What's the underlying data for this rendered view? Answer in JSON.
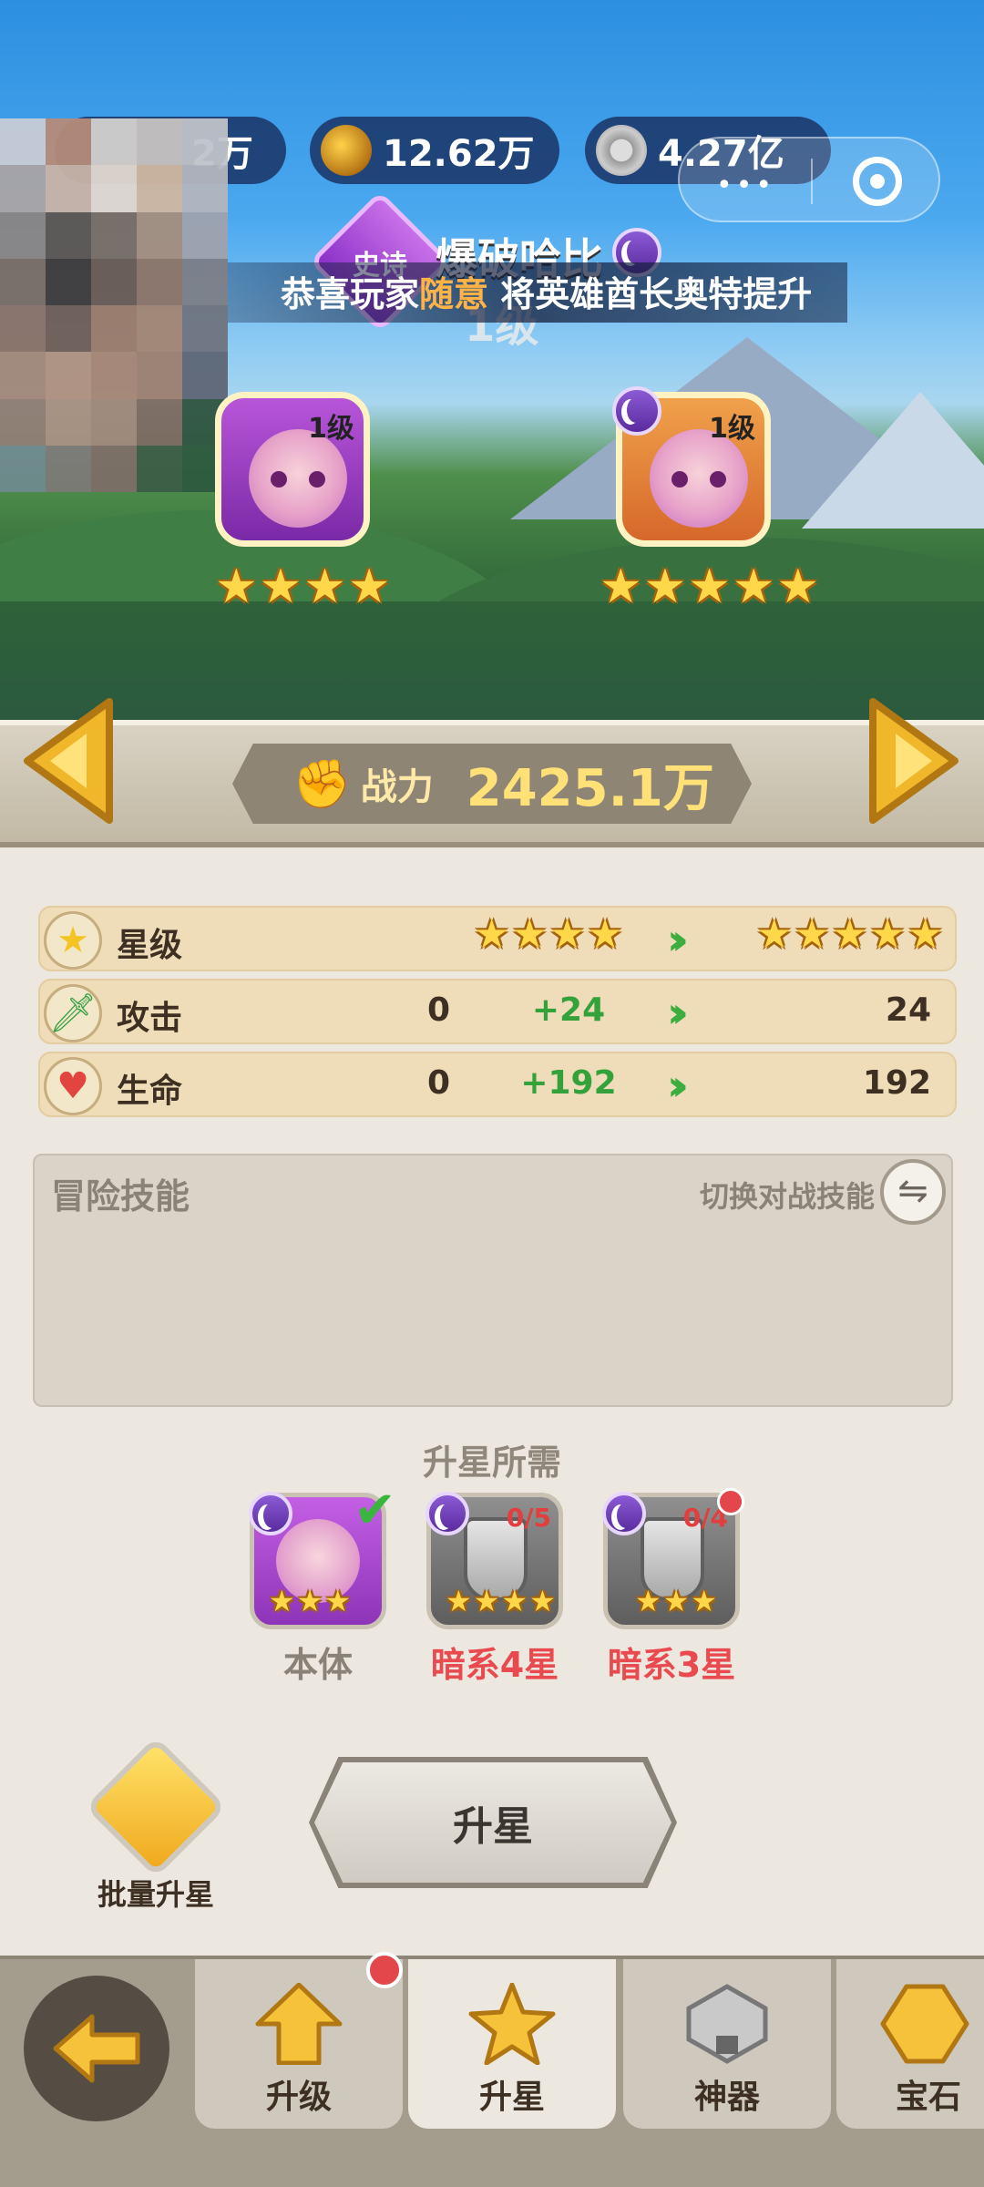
{
  "currencies": [
    {
      "name": "resource-1",
      "value": "2万",
      "icon": "unknown-currency-icon"
    },
    {
      "name": "gold",
      "value": "12.62万",
      "icon": "gold-ore-icon"
    },
    {
      "name": "coin",
      "value": "4.27亿",
      "icon": "coin-icon"
    }
  ],
  "miniprogram": {
    "more": "•••"
  },
  "hero": {
    "rarity": "史诗",
    "name": "爆破哈比",
    "level_overlay": "1级",
    "from_level": "1级",
    "to_level": "1级",
    "from_stars": 4,
    "to_stars": 5,
    "element": "dark-moon-icon"
  },
  "ticker": {
    "prefix": "恭喜玩家",
    "highlight": "随意",
    "suffix": "将英雄酋长奥特提升"
  },
  "power": {
    "label": "战力",
    "value": "2425.1万"
  },
  "stats": [
    {
      "name": "星级",
      "icon": "star-icon",
      "current_stars": 4,
      "next_stars": 5
    },
    {
      "name": "攻击",
      "icon": "sword-icon",
      "current": "0",
      "increase": "+24",
      "next": "24"
    },
    {
      "name": "生命",
      "icon": "heart-icon",
      "current": "0",
      "increase": "+192",
      "next": "192"
    }
  ],
  "skills": {
    "title": "冒险技能",
    "switch_label": "切换对战技能"
  },
  "requirements": {
    "title": "升星所需",
    "items": [
      {
        "label": "本体",
        "count": "",
        "color": "#8a8276",
        "met": true
      },
      {
        "label": "暗系4星",
        "count": "0/5",
        "color": "#e94a4f",
        "met": false
      },
      {
        "label": "暗系3星",
        "count": "0/4",
        "color": "#e94a4f",
        "met": false
      }
    ]
  },
  "actions": {
    "batch_label": "批量升星",
    "star_up_label": "升星"
  },
  "tabs": [
    {
      "label": "升级",
      "icon": "level-up-icon",
      "active": false,
      "badge": true
    },
    {
      "label": "升星",
      "icon": "star-up-icon",
      "active": true,
      "badge": false
    },
    {
      "label": "神器",
      "icon": "artifact-locked-icon",
      "active": false,
      "badge": false
    },
    {
      "label": "宝石",
      "icon": "gem-icon",
      "active": false,
      "badge": false
    }
  ],
  "colors": {
    "accent_green": "#33a23b",
    "warning_red": "#e94a4f",
    "gold": "#ffd84a"
  }
}
